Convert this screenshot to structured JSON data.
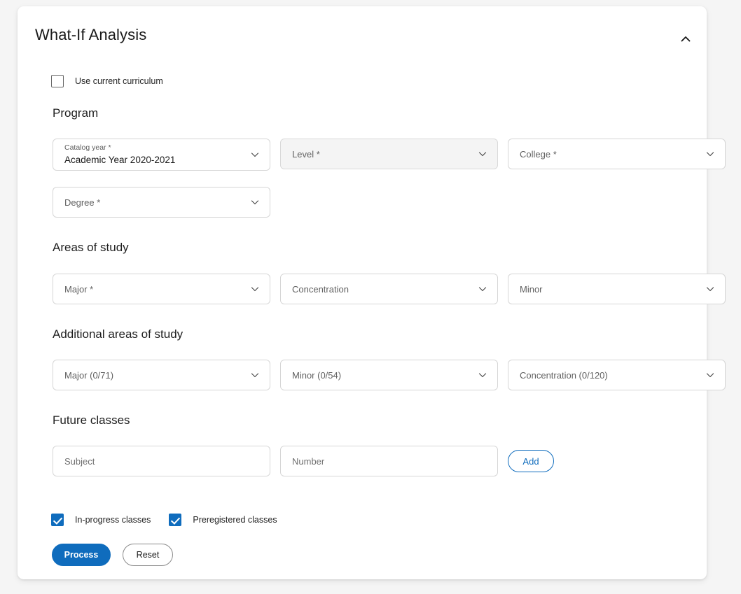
{
  "card": {
    "title": "What-If Analysis",
    "collapse_icon": "chevron-up-icon"
  },
  "use_current_curriculum": {
    "label": "Use current curriculum",
    "checked": false
  },
  "sections": {
    "program": {
      "heading": "Program",
      "fields": [
        {
          "name": "catalog-year",
          "floating_label": "Catalog year *",
          "value": "Academic Year 2020-2021",
          "state": "filled"
        },
        {
          "name": "level",
          "placeholder": "Level *",
          "state": "shaded"
        },
        {
          "name": "college",
          "placeholder": "College *",
          "state": "empty"
        },
        {
          "name": "degree",
          "placeholder": "Degree *",
          "state": "empty"
        }
      ]
    },
    "areas_of_study": {
      "heading": "Areas of study",
      "fields": [
        {
          "name": "major",
          "placeholder": "Major *"
        },
        {
          "name": "concentration",
          "placeholder": "Concentration"
        },
        {
          "name": "minor",
          "placeholder": "Minor"
        }
      ]
    },
    "additional_areas_of_study": {
      "heading": "Additional areas of study",
      "fields": [
        {
          "name": "additional-major",
          "placeholder": "Major (0/71)"
        },
        {
          "name": "additional-minor",
          "placeholder": "Minor (0/54)"
        },
        {
          "name": "additional-concentration",
          "placeholder": "Concentration (0/120)"
        }
      ]
    },
    "future_classes": {
      "heading": "Future classes",
      "subject_placeholder": "Subject",
      "subject_value": "",
      "number_placeholder": "Number",
      "number_value": "",
      "add_label": "Add"
    }
  },
  "options": {
    "in_progress": {
      "label": "In-progress classes",
      "checked": true
    },
    "preregistered": {
      "label": "Preregistered classes",
      "checked": true
    }
  },
  "actions": {
    "process_label": "Process",
    "reset_label": "Reset"
  },
  "colors": {
    "accent": "#0f6cbd",
    "page_bg": "#f5f5f5",
    "card_bg": "#ffffff",
    "field_border": "#d6d6d6",
    "shaded_field": "#f4f4f4"
  }
}
